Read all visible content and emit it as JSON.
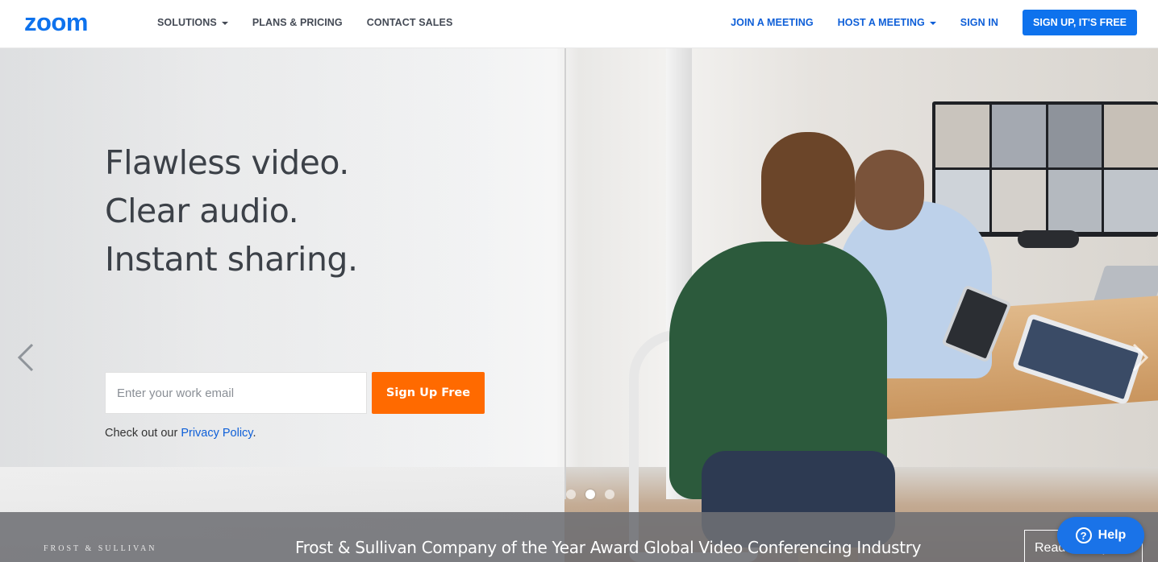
{
  "header": {
    "logo_text": "zoom",
    "nav_left": [
      {
        "label": "SOLUTIONS",
        "has_dropdown": true
      },
      {
        "label": "PLANS & PRICING",
        "has_dropdown": false
      },
      {
        "label": "CONTACT SALES",
        "has_dropdown": false
      }
    ],
    "nav_right": [
      {
        "label": "JOIN A MEETING",
        "has_dropdown": false
      },
      {
        "label": "HOST A MEETING",
        "has_dropdown": true
      },
      {
        "label": "SIGN IN",
        "has_dropdown": false
      }
    ],
    "signup_label": "SIGN UP, IT'S FREE"
  },
  "hero": {
    "headline": [
      "Flawless video.",
      "Clear audio.",
      "Instant sharing."
    ],
    "email_placeholder": "Enter your work email",
    "signup_button": "Sign Up Free",
    "privacy_prefix": "Check out our ",
    "privacy_link": "Privacy Policy",
    "privacy_suffix": ".",
    "carousel": {
      "slide_count": 3,
      "active_index": 1
    }
  },
  "award": {
    "logo_text": "FROST & SULLIVAN",
    "text": "Frost & Sullivan Company of the Year Award Global Video Conferencing Industry",
    "button_label": "Read the report"
  },
  "help": {
    "label": "Help"
  },
  "colors": {
    "brand_blue": "#0e72ed",
    "link_blue": "#0e5fd8",
    "cta_orange": "#ff6a00",
    "help_blue": "#1a73e8"
  },
  "icons": {
    "logo": "zoom-logo",
    "caret": "caret-down-icon",
    "prev": "chevron-left-icon",
    "next": "chevron-right-icon",
    "help": "question-circle-icon"
  }
}
